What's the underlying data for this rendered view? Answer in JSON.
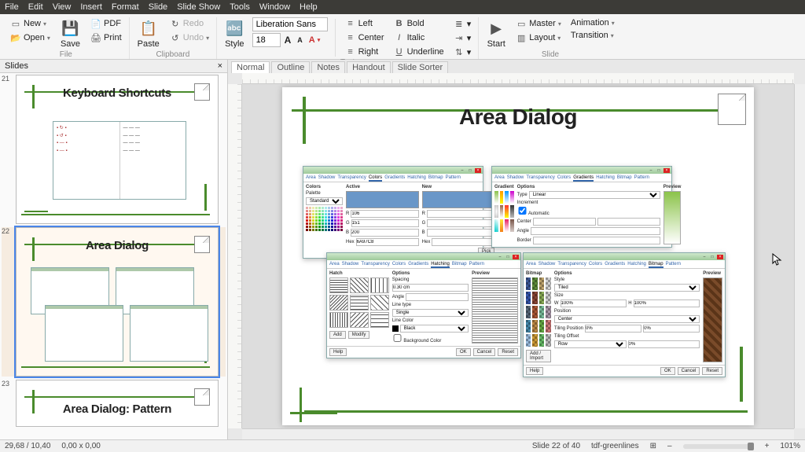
{
  "menubar": [
    "File",
    "Edit",
    "View",
    "Insert",
    "Format",
    "Slide",
    "Slide Show",
    "Tools",
    "Window",
    "Help"
  ],
  "ribbon": {
    "file": {
      "new": "New",
      "open": "Open",
      "pdf": "PDF",
      "save": "Save",
      "print": "Print",
      "label": "File"
    },
    "clipboard": {
      "paste": "Paste",
      "redo": "Redo",
      "undo": "Undo",
      "label": "Clipboard"
    },
    "text": {
      "style": "Style",
      "font_name": "Liberation Sans",
      "font_size": "18",
      "align_left": "Left",
      "align_center": "Center",
      "align_right": "Right",
      "bold": "Bold",
      "italic": "Italic",
      "underline": "Underline",
      "label": "Text"
    },
    "slide": {
      "start": "Start",
      "master": "Master",
      "layout": "Layout",
      "animation": "Animation",
      "transition": "Transition",
      "label": "Slide"
    }
  },
  "slides_panel": {
    "title": "Slides",
    "close": "×",
    "thumbs": [
      {
        "num": "21",
        "title": "Keyboard Shortcuts"
      },
      {
        "num": "22",
        "title": "Area Dialog"
      },
      {
        "num": "23",
        "title": "Area Dialog: Pattern"
      }
    ]
  },
  "view_tabs": [
    "Normal",
    "Outline",
    "Notes",
    "Handout",
    "Slide Sorter"
  ],
  "main_slide": {
    "title": "Area Dialog",
    "dlg_tabs": [
      "Area",
      "Shadow",
      "Transparency",
      "Colors",
      "Gradients",
      "Hatching",
      "Bitmap",
      "Pattern"
    ],
    "colors": {
      "header_colors": "Colors",
      "header_active": "Active",
      "header_new": "New",
      "pick": "Pick",
      "palette_label": "Palette",
      "palette_value": "Standard"
    },
    "gradients": {
      "header_g": "Gradient",
      "header_opt": "Options",
      "header_prev": "Preview",
      "type": "Type",
      "center": "Center",
      "increment": "Increment",
      "auto": "Automatic",
      "angle": "Angle",
      "border": "Border"
    },
    "hatch": {
      "header_h": "Hatch",
      "header_opt": "Options",
      "header_prev": "Preview",
      "spacing": "Spacing",
      "spacing_val": "0.30 cm",
      "angle": "Angle",
      "linetype": "Line type",
      "single": "Single",
      "linecolor": "Line Color",
      "black": "Black",
      "bg": "Background Color",
      "add": "Add",
      "modify": "Modify"
    },
    "bitmap": {
      "header_b": "Bitmap",
      "header_opt": "Options",
      "header_prev": "Preview",
      "style": "Style",
      "tiled": "Tiled",
      "size": "Size",
      "width": "W",
      "height": "H",
      "position": "Position",
      "center": "Center",
      "tiling": "Tiling Position",
      "offset": "Tiling Offset",
      "row": "Row",
      "add": "Add / Import"
    },
    "btn_ok": "OK",
    "btn_cancel": "Cancel",
    "btn_reset": "Reset",
    "btn_help": "Help"
  },
  "status": {
    "coords": "29,68 / 10,40",
    "size": "0,00 x 0,00",
    "slide": "Slide 22 of 40",
    "template": "tdf-greenlines",
    "zoom": "101%"
  }
}
